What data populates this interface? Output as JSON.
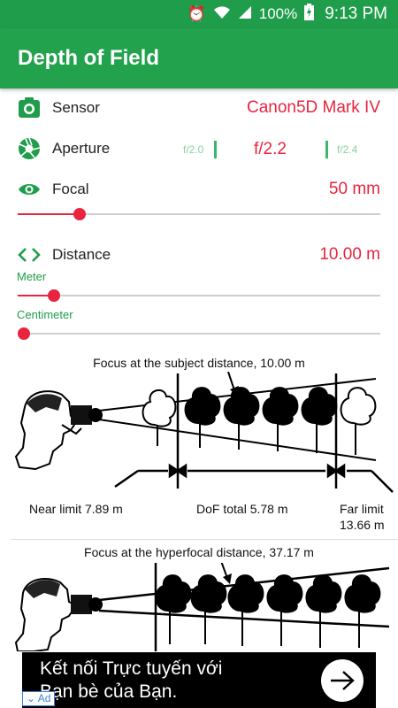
{
  "status_bar": {
    "battery": "100%",
    "time": "9:13 PM"
  },
  "app_bar": {
    "title": "Depth of Field",
    "color": "#23a24d"
  },
  "sensor": {
    "label": "Sensor",
    "value": "Canon5D Mark IV",
    "icon": "camera-icon"
  },
  "aperture": {
    "label": "Aperture",
    "prev": "f/2.0",
    "current": "f/2.2",
    "next": "f/2.4",
    "icon": "aperture-icon"
  },
  "focal": {
    "label": "Focal",
    "value": "50 mm",
    "icon": "eye-icon",
    "slider_fraction": 0.17
  },
  "distance": {
    "label": "Distance",
    "value": "10.00 m",
    "icon": "code-brackets-icon",
    "meter_label": "Meter",
    "meter_fraction": 0.1,
    "centimeter_label": "Centimeter",
    "centimeter_fraction": 0.0
  },
  "subject_diagram": {
    "caption": "Focus at the subject distance, 10.00 m",
    "near_limit": "Near limit 7.89 m",
    "dof_total": "DoF total 5.78 m",
    "far_limit_line1": "Far limit",
    "far_limit_line2": "13.66 m"
  },
  "hyperfocal_diagram": {
    "caption": "Focus at the hyperfocal distance, 37.17 m"
  },
  "ad": {
    "line1": "Kết nối Trực tuyến với",
    "line2": "Bạn bè của Bạn.",
    "badge": "Ad"
  },
  "colors": {
    "accent_red": "#e8243e",
    "green": "#1f9d4b"
  }
}
